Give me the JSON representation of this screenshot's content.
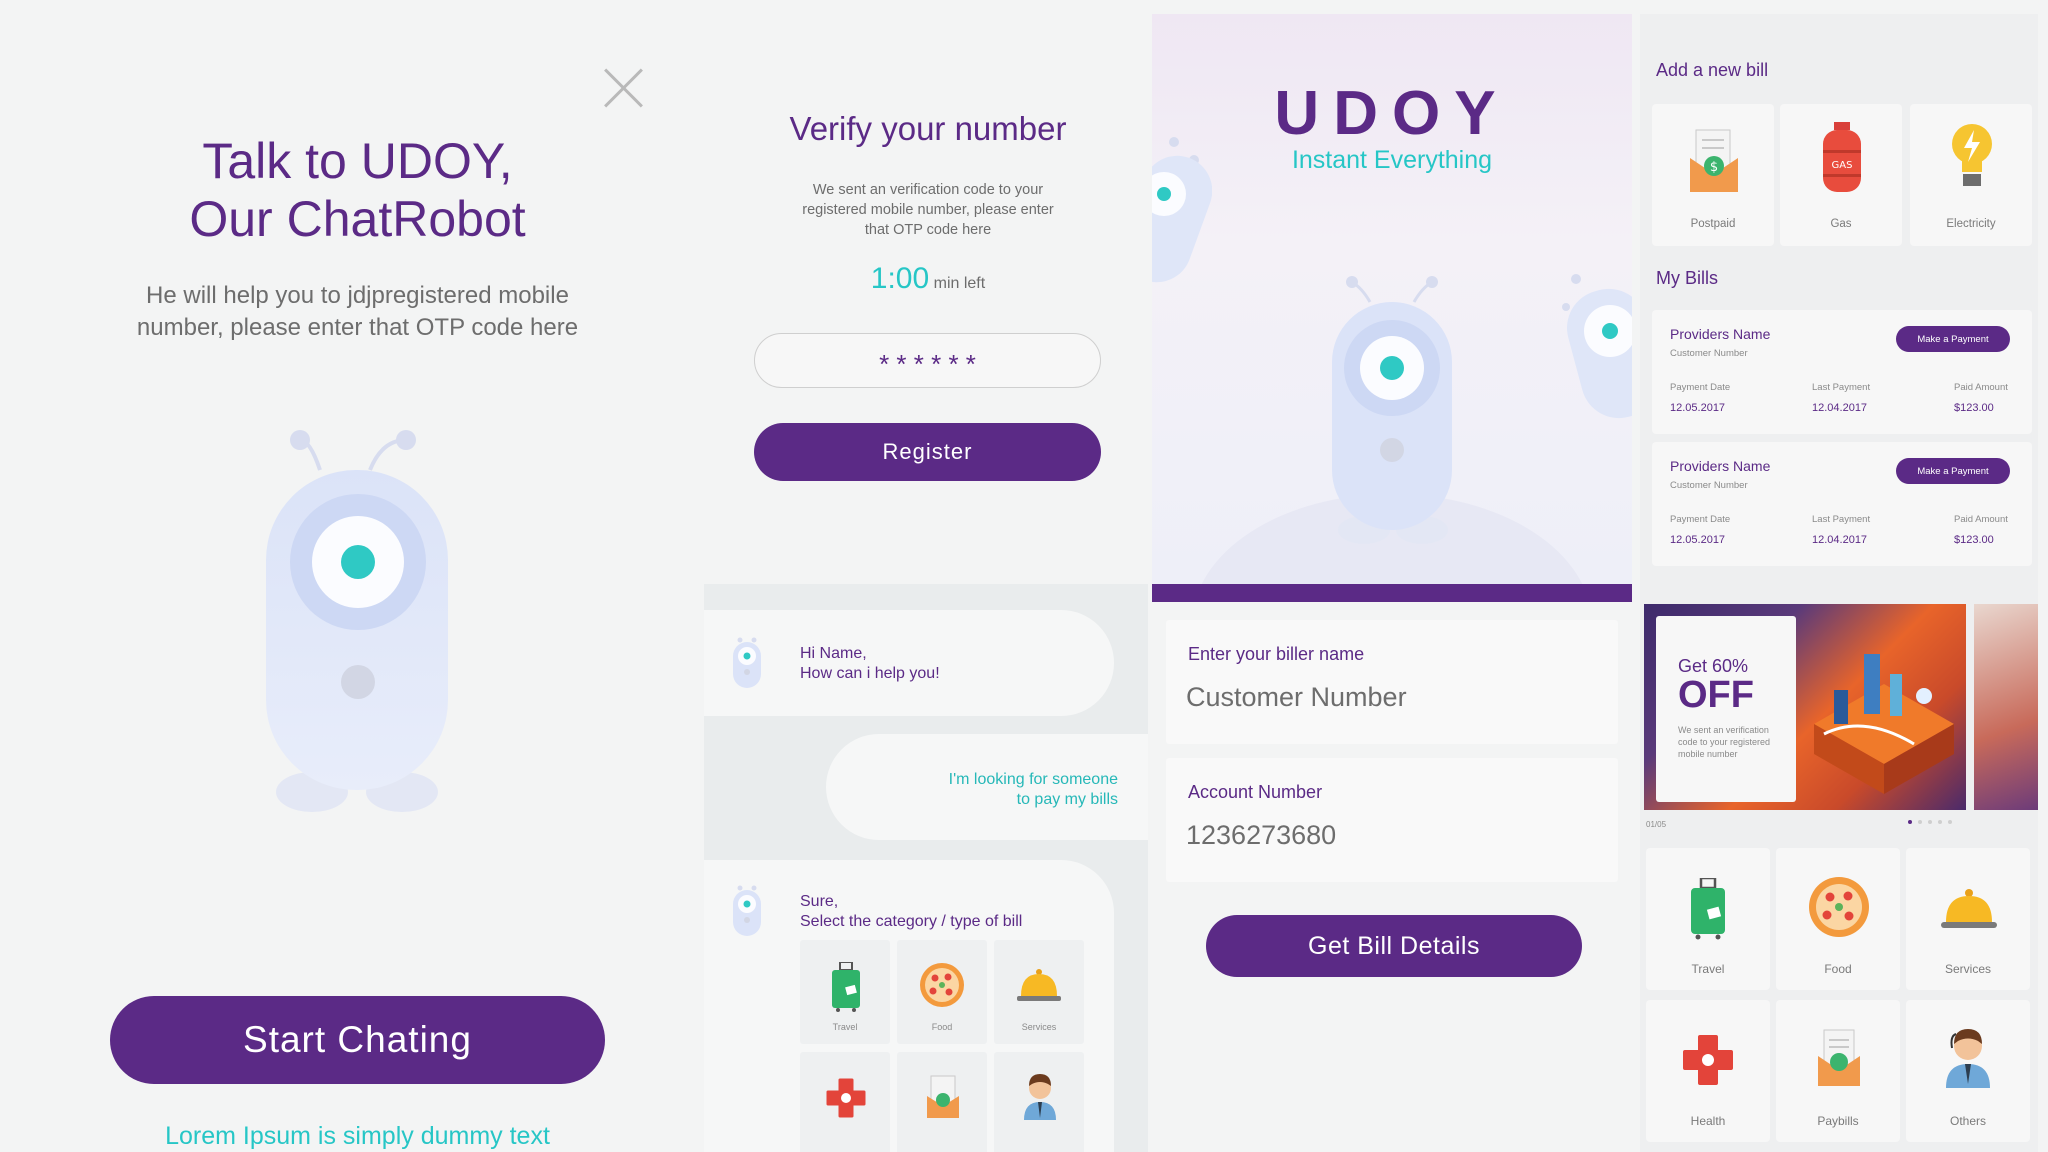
{
  "chat_intro": {
    "title_line1": "Talk to UDOY,",
    "title_line2": "Our ChatRobot",
    "description": "He will help you to jdjpregistered mobile number, please enter that OTP code here",
    "start_button": "Start Chating",
    "footer_text": "Lorem Ipsum is simply dummy text"
  },
  "verify": {
    "title": "Verify your number",
    "description": "We sent an verification code to your registered mobile number, please enter that OTP code here",
    "timer": "1:00",
    "timer_suffix": "min left",
    "otp_value": "* * * * * *",
    "register_button": "Register"
  },
  "splash": {
    "logo": "UDOY",
    "tagline": "Instant Everything"
  },
  "bills": {
    "add_title": "Add a new bill",
    "add_options": [
      {
        "label": "Postpaid",
        "icon": "postpaid-bill-icon"
      },
      {
        "label": "Gas",
        "icon": "gas-cylinder-icon"
      },
      {
        "label": "Electricity",
        "icon": "lightbulb-icon"
      }
    ],
    "gas_badge": "GAS",
    "my_bills_title": "My Bills",
    "items": [
      {
        "provider": "Providers Name",
        "customer": "Customer Number",
        "pay_button": "Make a Payment",
        "payment_date_label": "Payment Date",
        "payment_date": "12.05.2017",
        "last_payment_label": "Last Payment",
        "last_payment": "12.04.2017",
        "paid_amount_label": "Paid Amount",
        "paid_amount": "$123.00"
      },
      {
        "provider": "Providers Name",
        "customer": "Customer Number",
        "pay_button": "Make a Payment",
        "payment_date_label": "Payment Date",
        "payment_date": "12.05.2017",
        "last_payment_label": "Last Payment",
        "last_payment": "12.04.2017",
        "paid_amount_label": "Paid Amount",
        "paid_amount": "$123.00"
      }
    ]
  },
  "chat": {
    "msg1_line1": "Hi Name,",
    "msg1_line2": "How can i help you!",
    "msg2_line1": "I'm looking for someone",
    "msg2_line2": "to pay my bills",
    "msg3_line1": "Sure,",
    "msg3_line2": "Select the category / type of bill",
    "categories": [
      {
        "label": "Travel",
        "icon": "luggage-icon"
      },
      {
        "label": "Food",
        "icon": "pizza-icon"
      },
      {
        "label": "Services",
        "icon": "service-bell-icon"
      },
      {
        "label": "",
        "icon": "health-cross-icon"
      },
      {
        "label": "",
        "icon": "paybills-icon"
      },
      {
        "label": "",
        "icon": "support-agent-icon"
      }
    ]
  },
  "biller_form": {
    "biller_label": "Enter your biller name",
    "biller_value": "Customer Number",
    "account_label": "Account Number",
    "account_value": "1236273680",
    "submit_button": "Get Bill Details"
  },
  "categories_screen": {
    "promo_get": "Get 60%",
    "promo_off": "OFF",
    "promo_desc": "We sent an verification code to your registered mobile number",
    "slide_counter": "01/05",
    "items": [
      {
        "label": "Travel",
        "icon": "luggage-icon"
      },
      {
        "label": "Food",
        "icon": "pizza-icon"
      },
      {
        "label": "Services",
        "icon": "service-bell-icon"
      },
      {
        "label": "Health",
        "icon": "health-cross-icon"
      },
      {
        "label": "Paybills",
        "icon": "paybills-icon"
      },
      {
        "label": "Others",
        "icon": "support-agent-icon"
      }
    ]
  },
  "colors": {
    "primary": "#5b2a86",
    "accent": "#26c6c6",
    "background": "#f3f4f4"
  }
}
